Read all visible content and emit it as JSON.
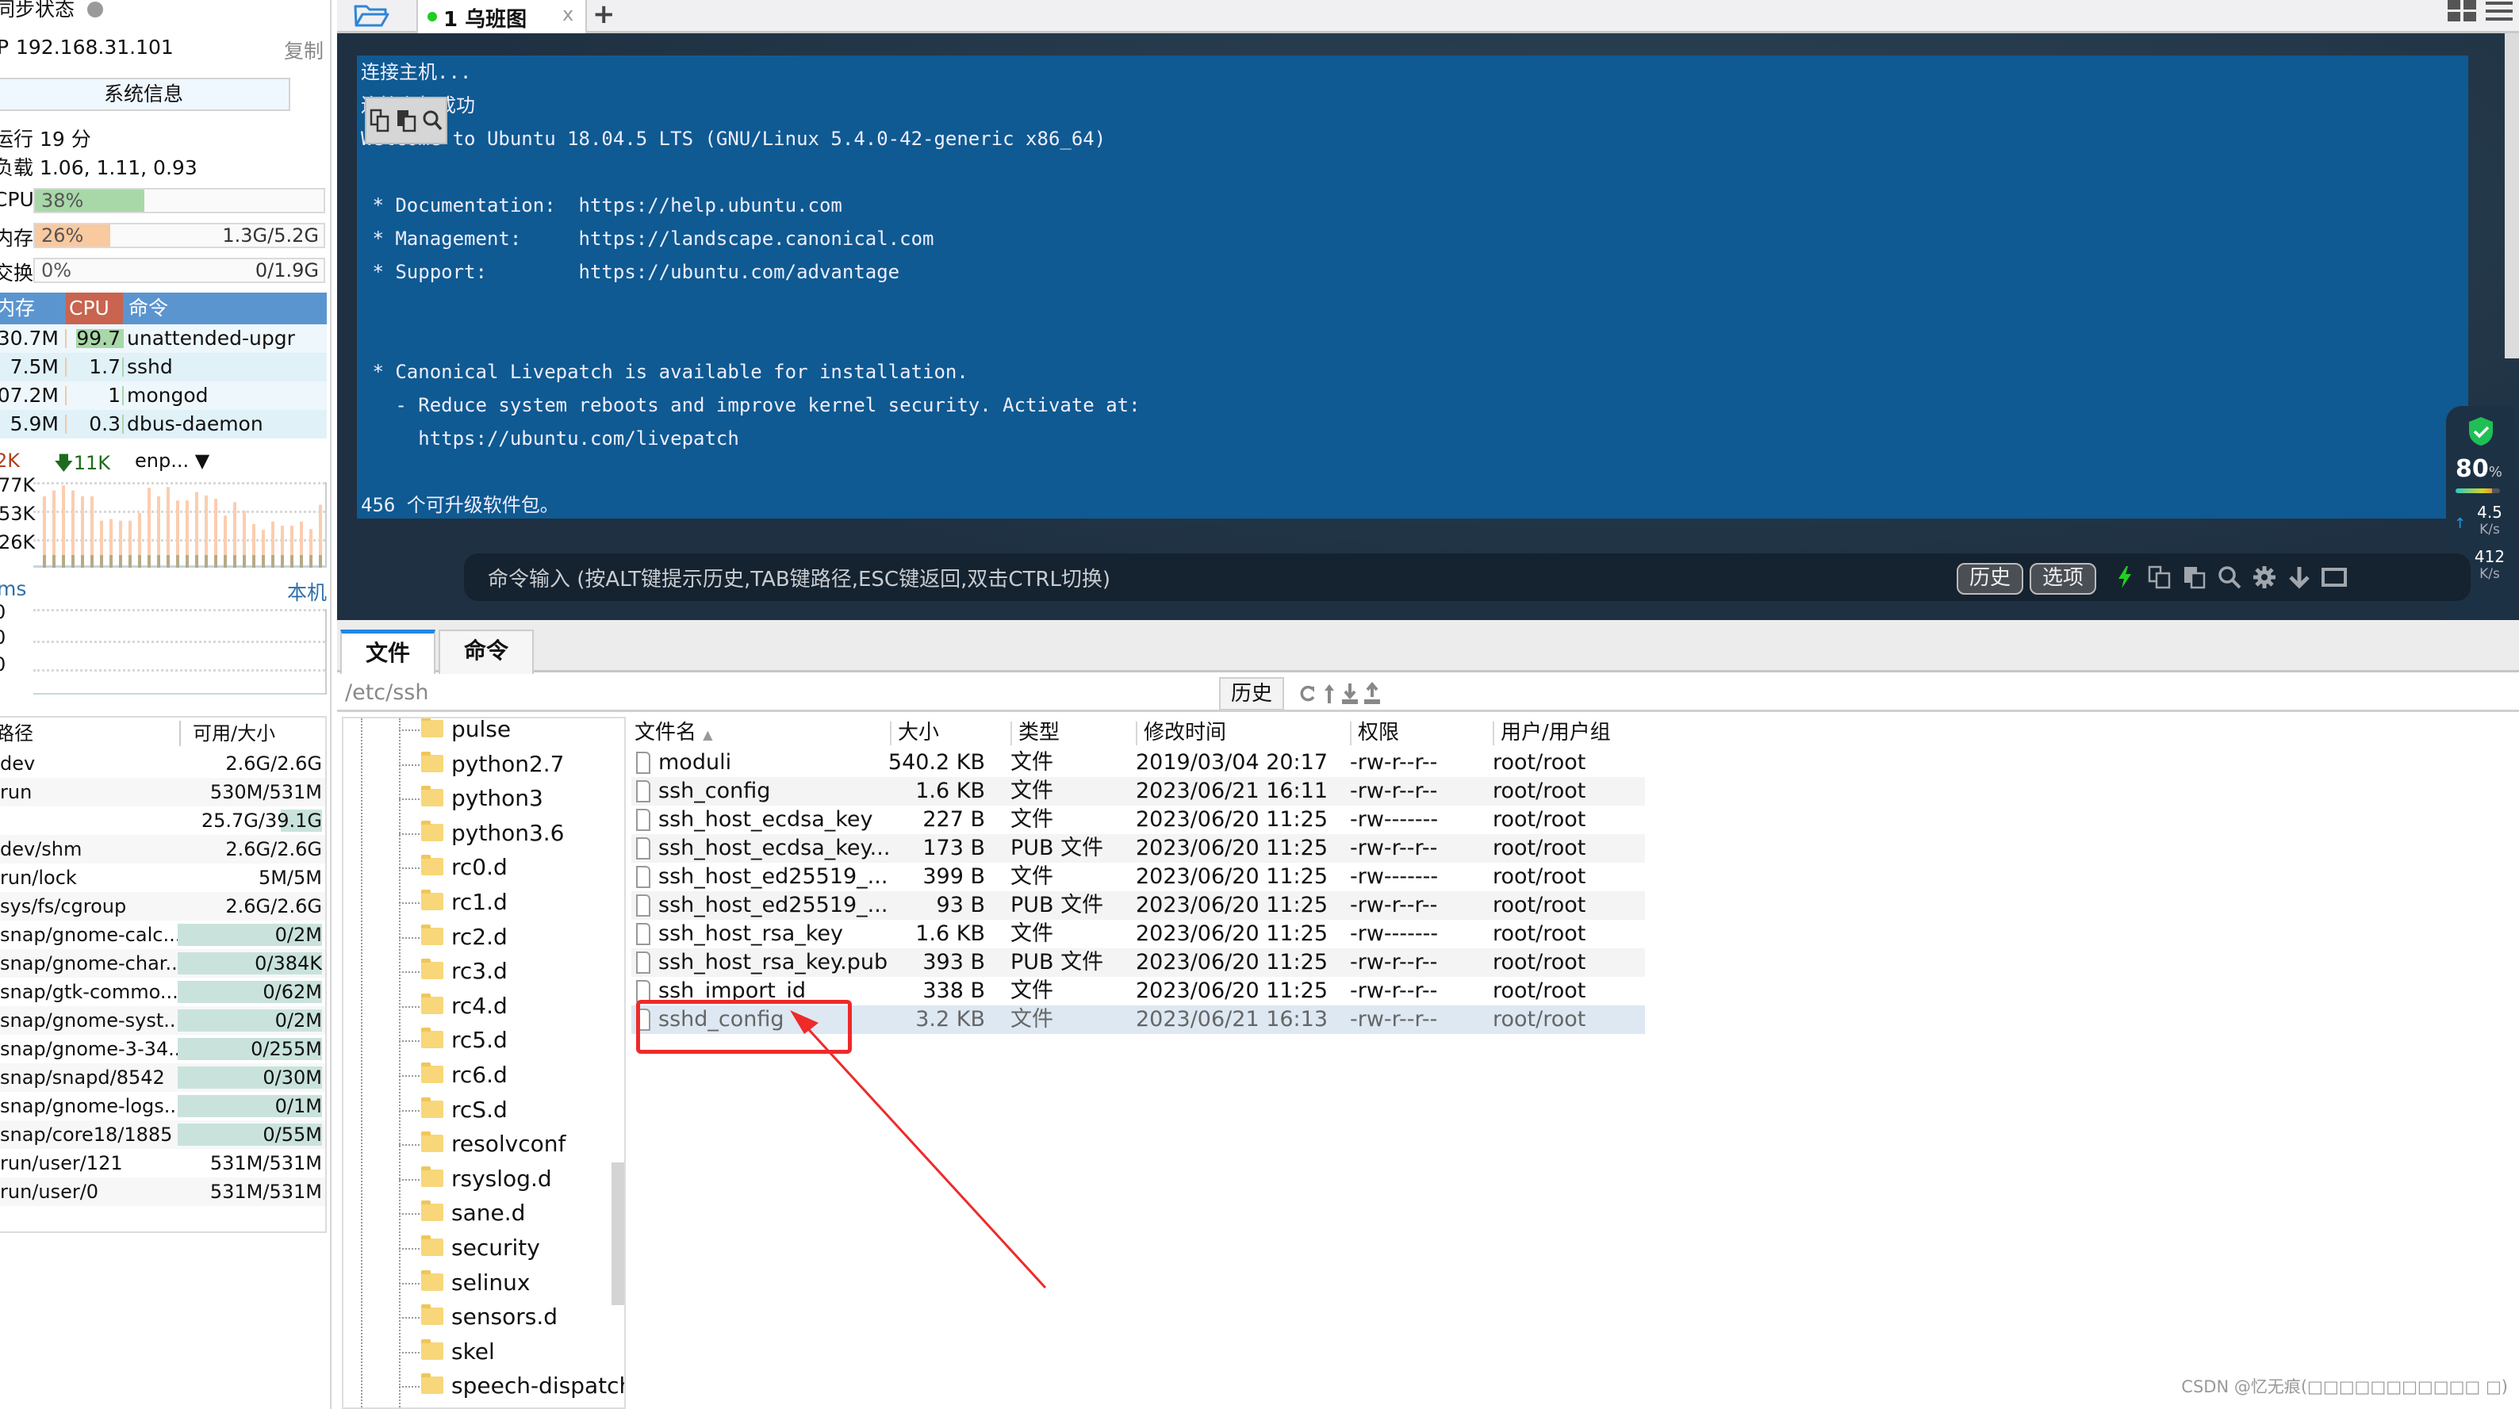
{
  "sidebar": {
    "sync_label": "同步状态",
    "ip_label": "P",
    "ip": "192.168.31.101",
    "copy_label": "复制",
    "sysinfo_button": "系统信息",
    "uptime": "运行 19 分",
    "load": "负载 1.06, 1.11, 0.93",
    "meters": [
      {
        "label": "CPU",
        "percent_text": "38%",
        "value": "",
        "fraction": 0.38,
        "color": "#a8d8a8"
      },
      {
        "label": "内存",
        "percent_text": "26%",
        "value": "1.3G/5.2G",
        "fraction": 0.26,
        "color": "#f9c9a0"
      },
      {
        "label": "交换",
        "percent_text": "0%",
        "value": "0/1.9G",
        "fraction": 0.0,
        "color": "#f9c9a0"
      }
    ],
    "process_table": {
      "headers": {
        "mem": "内存",
        "cpu": "CPU",
        "cmd": "命令"
      },
      "rows": [
        {
          "mem": "30.7M",
          "cpu": "99.7",
          "cmd": "unattended-upgr",
          "cpu_highlight": true
        },
        {
          "mem": "7.5M",
          "cpu": "1.7",
          "cmd": "sshd",
          "cpu_highlight": false
        },
        {
          "mem": "07.2M",
          "cpu": "1",
          "cmd": "mongod",
          "cpu_highlight": false
        },
        {
          "mem": "5.9M",
          "cpu": "0.3",
          "cmd": "dbus-daemon",
          "cpu_highlight": false
        }
      ]
    },
    "network": {
      "up": "2K",
      "down": "11K",
      "interface": "enp...",
      "y_labels": [
        "77K",
        "53K",
        "26K"
      ]
    },
    "latency": {
      "unit": "ms",
      "target": "本机",
      "y_labels": [
        "0",
        "0",
        "0"
      ]
    },
    "disk_table": {
      "headers": {
        "path": "路径",
        "size": "可用/大小"
      },
      "rows": [
        {
          "path": "dev",
          "size": "2.6G/2.6G",
          "used": 0
        },
        {
          "path": "run",
          "size": "530M/531M",
          "used": 0
        },
        {
          "path": "",
          "size": "25.7G/39.1G",
          "used": 0.34
        },
        {
          "path": "dev/shm",
          "size": "2.6G/2.6G",
          "used": 0
        },
        {
          "path": "run/lock",
          "size": "5M/5M",
          "used": 0
        },
        {
          "path": "sys/fs/cgroup",
          "size": "2.6G/2.6G",
          "used": 0
        },
        {
          "path": "snap/gnome-calc...",
          "size": "0/2M",
          "used": 1
        },
        {
          "path": "snap/gnome-char...",
          "size": "0/384K",
          "used": 1
        },
        {
          "path": "snap/gtk-commo...",
          "size": "0/62M",
          "used": 1
        },
        {
          "path": "snap/gnome-syst...",
          "size": "0/2M",
          "used": 1
        },
        {
          "path": "snap/gnome-3-34...",
          "size": "0/255M",
          "used": 1
        },
        {
          "path": "snap/snapd/8542",
          "size": "0/30M",
          "used": 1
        },
        {
          "path": "snap/gnome-logs...",
          "size": "0/1M",
          "used": 1
        },
        {
          "path": "snap/core18/1885",
          "size": "0/55M",
          "used": 1
        },
        {
          "path": "run/user/121",
          "size": "531M/531M",
          "used": 0
        },
        {
          "path": "run/user/0",
          "size": "531M/531M",
          "used": 0
        }
      ]
    }
  },
  "tabbar": {
    "tabs": [
      {
        "label": "1 乌班图",
        "close": "x",
        "connected": true
      }
    ],
    "add_label": "+"
  },
  "terminal": {
    "lines": [
      "连接主机...",
      "连接主机成功",
      "Welcome to Ubuntu 18.04.5 LTS (GNU/Linux 5.4.0-42-generic x86_64)",
      "",
      " * Documentation:  https://help.ubuntu.com",
      " * Management:     https://landscape.canonical.com",
      " * Support:        https://ubuntu.com/advantage",
      "",
      "",
      " * Canonical Livepatch is available for installation.",
      "   - Reduce system reboots and improve kernel security. Activate at:",
      "     https://ubuntu.com/livepatch",
      "",
      "456 个可升级软件包。"
    ],
    "status_widget": {
      "percent": "80",
      "percent_unit": "%",
      "percent_value": 0.8,
      "up_speed": "4.5",
      "down_speed": "412",
      "speed_unit": "K/s"
    },
    "command_bar": {
      "placeholder": "命令输入 (按ALT键提示历史,TAB键路径,ESC键返回,双击CTRL切换)",
      "history_button": "历史",
      "options_button": "选项"
    }
  },
  "file_panel": {
    "tabs": [
      {
        "label": "文件",
        "active": true
      },
      {
        "label": "命令",
        "active": false
      }
    ],
    "path": "/etc/ssh",
    "history_button": "历史",
    "tree": [
      "pulse",
      "python2.7",
      "python3",
      "python3.6",
      "rc0.d",
      "rc1.d",
      "rc2.d",
      "rc3.d",
      "rc4.d",
      "rc5.d",
      "rc6.d",
      "rcS.d",
      "resolvconf",
      "rsyslog.d",
      "sane.d",
      "security",
      "selinux",
      "sensors.d",
      "skel",
      "speech-dispatch"
    ],
    "columns": {
      "name": "文件名",
      "size": "大小",
      "type": "类型",
      "mtime": "修改时间",
      "perm": "权限",
      "owner": "用户/用户组"
    },
    "sort_indicator": "▲",
    "files": [
      {
        "name": "moduli",
        "size": "540.2 KB",
        "type": "文件",
        "mtime": "2019/03/04 20:17",
        "perm": "-rw-r--r--",
        "owner": "root/root"
      },
      {
        "name": "ssh_config",
        "size": "1.6 KB",
        "type": "文件",
        "mtime": "2023/06/21 16:11",
        "perm": "-rw-r--r--",
        "owner": "root/root"
      },
      {
        "name": "ssh_host_ecdsa_key",
        "size": "227 B",
        "type": "文件",
        "mtime": "2023/06/20 11:25",
        "perm": "-rw-------",
        "owner": "root/root"
      },
      {
        "name": "ssh_host_ecdsa_key...",
        "size": "173 B",
        "type": "PUB 文件",
        "mtime": "2023/06/20 11:25",
        "perm": "-rw-r--r--",
        "owner": "root/root"
      },
      {
        "name": "ssh_host_ed25519_...",
        "size": "399 B",
        "type": "文件",
        "mtime": "2023/06/20 11:25",
        "perm": "-rw-------",
        "owner": "root/root"
      },
      {
        "name": "ssh_host_ed25519_...",
        "size": "93 B",
        "type": "PUB 文件",
        "mtime": "2023/06/20 11:25",
        "perm": "-rw-r--r--",
        "owner": "root/root"
      },
      {
        "name": "ssh_host_rsa_key",
        "size": "1.6 KB",
        "type": "文件",
        "mtime": "2023/06/20 11:25",
        "perm": "-rw-------",
        "owner": "root/root"
      },
      {
        "name": "ssh_host_rsa_key.pub",
        "size": "393 B",
        "type": "PUB 文件",
        "mtime": "2023/06/20 11:25",
        "perm": "-rw-r--r--",
        "owner": "root/root"
      },
      {
        "name": "ssh_import_id",
        "size": "338 B",
        "type": "文件",
        "mtime": "2023/06/20 11:25",
        "perm": "-rw-r--r--",
        "owner": "root/root"
      },
      {
        "name": "sshd_config",
        "size": "3.2 KB",
        "type": "文件",
        "mtime": "2023/06/21 16:13",
        "perm": "-rw-r--r--",
        "owner": "root/root",
        "selected": true
      }
    ]
  },
  "annotation": {
    "color": "#ee2a2a",
    "target": "sshd_config"
  },
  "watermark": "CSDN @忆无痕(□□□□□□□□□□□ □)"
}
